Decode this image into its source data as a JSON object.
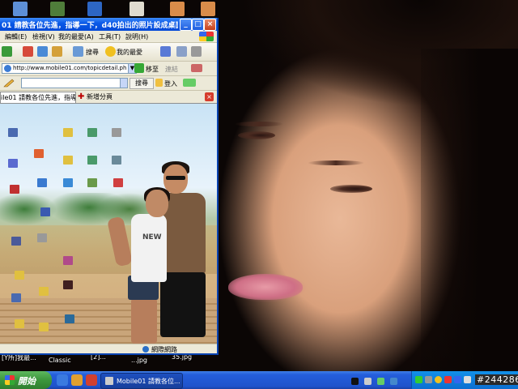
{
  "window": {
    "title": "01 請教各位先進，指導一下，d40拍出的照片設成桌面，會...",
    "menu": [
      "編輯(E)",
      "檢視(V)",
      "我的最愛(A)",
      "工具(T)",
      "說明(H)"
    ],
    "toolbar": {
      "search": "搜尋",
      "favorites": "我的最愛"
    },
    "address": "http://www.mobile01.com/topicdetail.php?f=2",
    "go": "移至",
    "links": "連結",
    "search_button": "搜尋",
    "login_button": "登入",
    "tab_title": "ile01 請教各位先進，指導...",
    "new_tab": "新增分頁",
    "status": "網際網路"
  },
  "desktop_bottom_labels": [
    "[Y所]我最...",
    "Classic",
    "[2]...",
    "...jpg",
    "35.jpg"
  ],
  "shirt_text": "NEW",
  "taskbar": {
    "start": "開始",
    "task_item": "Mobile01 請教各位...",
    "tray_text": "#244286"
  },
  "colors": {
    "titlebar": "#0b5ae8",
    "taskbar": "#245edb",
    "start": "#3c963c"
  }
}
